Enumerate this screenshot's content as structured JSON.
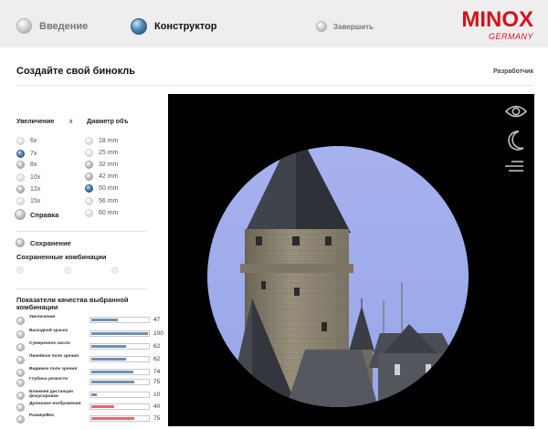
{
  "nav": {
    "steps": [
      {
        "label": "Введение",
        "state": "inactive"
      },
      {
        "label": "Конструктор",
        "state": "active"
      },
      {
        "label": "Завершить",
        "state": "inactive"
      }
    ]
  },
  "logo": {
    "brand": "MINOX",
    "country": "GERMANY"
  },
  "page": {
    "title": "Создайте свой бинокль",
    "developer_link": "Разработчик"
  },
  "config": {
    "magnification_header": "Увеличение",
    "separator": "x",
    "diameter_header": "Диаметр объ",
    "magnifications": [
      {
        "label": "6x",
        "selected": false
      },
      {
        "label": "7x",
        "selected": true
      },
      {
        "label": "8x",
        "selected": false
      },
      {
        "label": "10x",
        "selected": false
      },
      {
        "label": "12x",
        "selected": false
      },
      {
        "label": "15x",
        "selected": false
      }
    ],
    "diameters": [
      {
        "label": "18 mm",
        "selected": false
      },
      {
        "label": "25 mm",
        "selected": false
      },
      {
        "label": "32 mm",
        "selected": false
      },
      {
        "label": "42 mm",
        "selected": false
      },
      {
        "label": "50 mm",
        "selected": true
      },
      {
        "label": "56 mm",
        "selected": false
      },
      {
        "label": "60 mm",
        "selected": false
      }
    ],
    "help_label": "Справка"
  },
  "saving": {
    "save_label": "Сохранение",
    "saved_combinations_label": "Сохраненные комбинации"
  },
  "metrics": {
    "title": "Показатели качества выбранной комбинации",
    "items": [
      {
        "label": "Увеличение",
        "value": 47,
        "color": "#6f8fb3"
      },
      {
        "label": "Выходной зрачок",
        "value": 100,
        "color": "#6f8fb3"
      },
      {
        "label": "Сумеречное число",
        "value": 62,
        "color": "#6f8fb3"
      },
      {
        "label": "Линейное поле зрения",
        "value": 62,
        "color": "#6f8fb3"
      },
      {
        "label": "Видимое поле зрения",
        "value": 74,
        "color": "#6f8fb3"
      },
      {
        "label": "Глубина резкости",
        "value": 75,
        "color": "#6f8fb3"
      },
      {
        "label": "Ближняя дистанция фокусировки",
        "value": 10,
        "color": "#6f8fb3"
      },
      {
        "label": "Дрожание изображения",
        "value": 40,
        "color": "#e86a6a"
      },
      {
        "label": "Размер/Вес",
        "value": 75,
        "color": "#e86a6a"
      }
    ]
  },
  "viewer": {
    "icons": [
      "eye-icon",
      "moon-icon",
      "settings-lines-icon"
    ],
    "colors": {
      "background": "#000000",
      "sky": "#a7b2ee",
      "roof": "#3f434b",
      "stone": "#8c8471"
    }
  }
}
